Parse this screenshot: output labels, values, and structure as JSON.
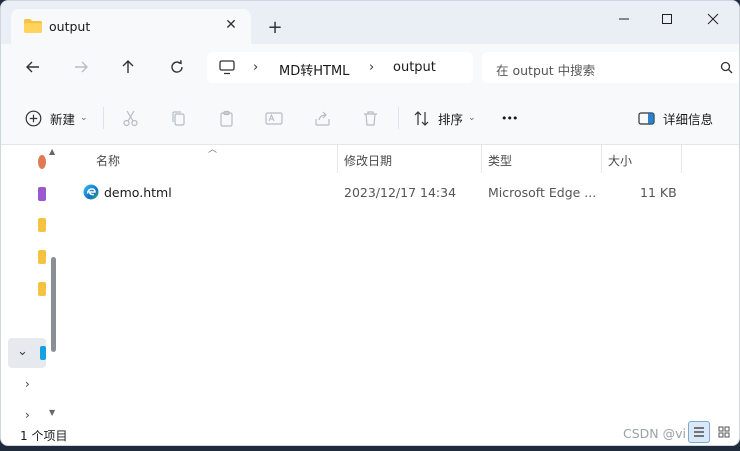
{
  "tab": {
    "title": "output",
    "close_glyph": "✕"
  },
  "new_tab_glyph": "+",
  "window_controls": {
    "minimize": "—",
    "maximize": "☐",
    "close": "✕"
  },
  "address": {
    "breadcrumbs": [
      "MD转HTML",
      "output"
    ],
    "chevron": "›"
  },
  "search": {
    "placeholder": "在 output 中搜索"
  },
  "commands": {
    "new_label": "新建",
    "sort_label": "排序",
    "more_label": "•••",
    "details_label": "详细信息"
  },
  "columns": {
    "name": "名称",
    "modified": "修改日期",
    "type": "类型",
    "size": "大小"
  },
  "files": [
    {
      "name": "demo.html",
      "modified": "2023/12/17 14:34",
      "type": "Microsoft Edge ...",
      "size": "11 KB",
      "icon": "edge-html-icon"
    }
  ],
  "status": {
    "item_count": "1 个项目"
  },
  "watermark": "CSDN @vi",
  "colors": {
    "accent": "#0f6cbd",
    "folder": "#f5c242",
    "titlebar": "#e9eff5",
    "toolbar": "#f7f9fb"
  }
}
